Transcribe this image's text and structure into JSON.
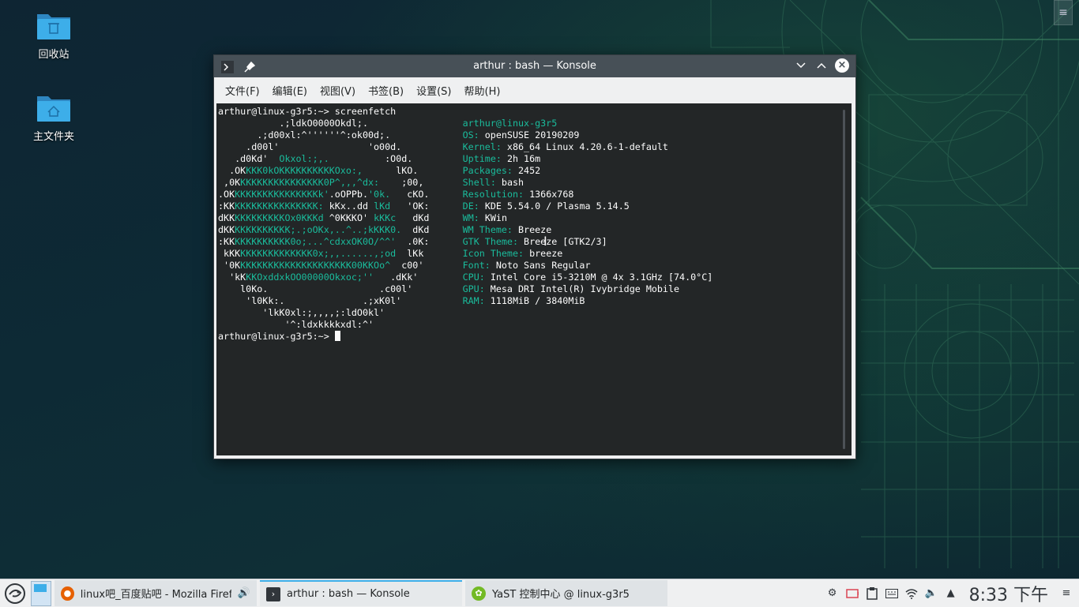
{
  "desktop": {
    "icons": [
      {
        "label": "回收站",
        "icon": "trash-folder-icon"
      },
      {
        "label": "主文件夹",
        "icon": "home-folder-icon"
      }
    ],
    "menu_icon": "hamburger-icon"
  },
  "window": {
    "title": "arthur : bash — Konsole",
    "menu": [
      "文件(F)",
      "编辑(E)",
      "视图(V)",
      "书签(B)",
      "设置(S)",
      "帮助(H)"
    ]
  },
  "terminal": {
    "prompt": "arthur@linux-g3r5:~> ",
    "command": "screenfetch",
    "logo": [
      [
        [
          "           .;ldkO0000Okdl;.           ",
          "w"
        ]
      ],
      [
        [
          "       .;d00xl:^''''''^:ok00d;.       ",
          "w"
        ]
      ],
      [
        [
          "     .d00l'                'o00d.     ",
          "w"
        ]
      ],
      [
        [
          "   .d0Kd'  ",
          "w"
        ],
        [
          "Okxol:;,.",
          "g"
        ],
        [
          "          :O0d.   ",
          "w"
        ]
      ],
      [
        [
          "  .OK",
          "w"
        ],
        [
          "KKK0kOKKKKKKKKKKOxo:,",
          "g"
        ],
        [
          "      lKO.  ",
          "w"
        ]
      ],
      [
        [
          " ,0K",
          "w"
        ],
        [
          "KKKKKKKKKKKKKKK0P^,,,^dx:",
          "g"
        ],
        [
          "    ;00,  ",
          "w"
        ]
      ],
      [
        [
          ".OK",
          "w"
        ],
        [
          "KKKKKKKKKKKKKKKk'",
          "g"
        ],
        [
          ".oOPPb.",
          "w"
        ],
        [
          "'0k.",
          "g"
        ],
        [
          "   cKO. ",
          "w"
        ]
      ],
      [
        [
          ":KK",
          "w"
        ],
        [
          "KKKKKKKKKKKKKKK:",
          "g"
        ],
        [
          " kKx..dd ",
          "w"
        ],
        [
          "lKd",
          "g"
        ],
        [
          "   'OK: ",
          "w"
        ]
      ],
      [
        [
          "dKK",
          "w"
        ],
        [
          "KKKKKKKKKOx0KKKd",
          "g"
        ],
        [
          " ^0KKKO' ",
          "w"
        ],
        [
          "kKKc",
          "g"
        ],
        [
          "   dKd ",
          "w"
        ]
      ],
      [
        [
          "dKK",
          "w"
        ],
        [
          "KKKKKKKKKK;.;oOKx,..^..;kKKK0.",
          "g"
        ],
        [
          "  dKd ",
          "w"
        ]
      ],
      [
        [
          ":KK",
          "w"
        ],
        [
          "KKKKKKKKKK0o;...^cdxxOK0O/^^'",
          "g"
        ],
        [
          "  .0K: ",
          "w"
        ]
      ],
      [
        [
          " kKK",
          "w"
        ],
        [
          "KKKKKKKKKKKKK0x;,,......,;od",
          "g"
        ],
        [
          "  lKk  ",
          "w"
        ]
      ],
      [
        [
          " '0K",
          "w"
        ],
        [
          "KKKKKKKKKKKKKKKKKKKK00KKOo^",
          "g"
        ],
        [
          "  c00'  ",
          "w"
        ]
      ],
      [
        [
          "  'kK",
          "w"
        ],
        [
          "KKOxddxkOO00000Okxoc;''",
          "g"
        ],
        [
          "   .dKk'  ",
          "w"
        ]
      ],
      [
        [
          "    l0Ko.                    .c00l'    ",
          "w"
        ]
      ],
      [
        [
          "     'l0Kk:.              .;xK0l'     ",
          "w"
        ]
      ],
      [
        [
          "        'lkK0xl:;,,,,;:ldO0kl'        ",
          "w"
        ]
      ],
      [
        [
          "            '^:ldxkkkkxdl:^'           ",
          "w"
        ]
      ]
    ],
    "info_header_user": "arthur",
    "info_header_host": "@linux-g3r5",
    "info": [
      {
        "key": "OS:",
        "value": "openSUSE 20190209"
      },
      {
        "key": "Kernel:",
        "value": "x86_64 Linux 4.20.6-1-default"
      },
      {
        "key": "Uptime:",
        "value": "2h 16m"
      },
      {
        "key": "Packages:",
        "value": "2452"
      },
      {
        "key": "Shell:",
        "value": "bash"
      },
      {
        "key": "Resolution:",
        "value": "1366x768"
      },
      {
        "key": "DE:",
        "value": "KDE 5.54.0 / Plasma 5.14.5"
      },
      {
        "key": "WM:",
        "value": "KWin"
      },
      {
        "key": "WM Theme:",
        "value": "Breeze"
      },
      {
        "key": "GTK Theme:",
        "value": "Breeze [GTK2/3]"
      },
      {
        "key": "Icon Theme:",
        "value": "breeze"
      },
      {
        "key": "Font:",
        "value": "Noto Sans Regular"
      },
      {
        "key": "CPU:",
        "value": "Intel Core i5-3210M @ 4x 3.1GHz [74.0°C]"
      },
      {
        "key": "GPU:",
        "value": "Mesa DRI Intel(R) Ivybridge Mobile"
      },
      {
        "key": "RAM:",
        "value": "1118MiB / 3840MiB"
      }
    ]
  },
  "taskbar": {
    "tasks": [
      {
        "label": "linux吧_百度贴吧 - Mozilla Firef…",
        "icon": "firefox-icon",
        "color": "#e66000"
      },
      {
        "label": "arthur : bash — Konsole",
        "icon": "konsole-icon",
        "color": "#31363b"
      },
      {
        "label": "YaST 控制中心 @ linux-g3r5",
        "icon": "yast-icon",
        "color": "#73ba25"
      }
    ],
    "clock": "8:33 下午",
    "accent": "#3daee9"
  }
}
